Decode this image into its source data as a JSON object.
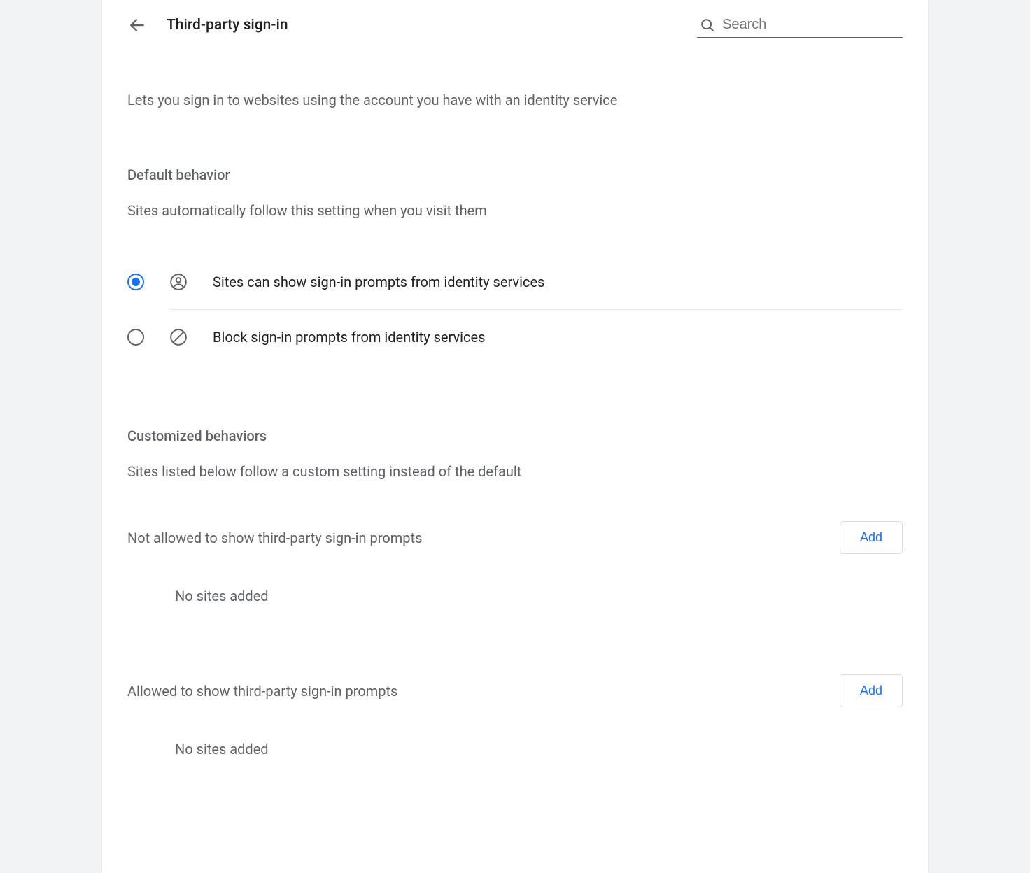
{
  "header": {
    "title": "Third-party sign-in",
    "search_placeholder": "Search"
  },
  "description": "Lets you sign in to websites using the account you have with an identity service",
  "default_behavior": {
    "title": "Default behavior",
    "description": "Sites automatically follow this setting when you visit them",
    "options": [
      {
        "label": "Sites can show sign-in prompts from identity services",
        "selected": true,
        "icon": "person-circle-icon"
      },
      {
        "label": "Block sign-in prompts from identity services",
        "selected": false,
        "icon": "block-icon"
      }
    ]
  },
  "customized_behaviors": {
    "title": "Customized behaviors",
    "description": "Sites listed below follow a custom setting instead of the default",
    "lists": [
      {
        "title": "Not allowed to show third-party sign-in prompts",
        "add_label": "Add",
        "empty_text": "No sites added"
      },
      {
        "title": "Allowed to show third-party sign-in prompts",
        "add_label": "Add",
        "empty_text": "No sites added"
      }
    ]
  }
}
